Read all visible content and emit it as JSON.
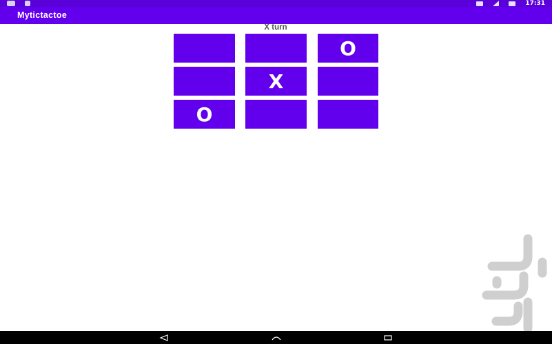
{
  "status_bar": {
    "clock": "17:31",
    "icons": [
      "notification-icon",
      "lock-icon",
      "vibrate-icon",
      "wifi-icon",
      "battery-icon"
    ]
  },
  "app_bar": {
    "title": "Mytictactoe"
  },
  "game": {
    "turn_text": "X turn",
    "board": [
      "",
      "",
      "O",
      "",
      "X",
      "",
      "O",
      "",
      ""
    ]
  },
  "nav_bar": {
    "icons": [
      "back-icon",
      "home-icon",
      "recents-icon"
    ]
  },
  "colors": {
    "primary": "#6200ee",
    "status_bar": "#5a00d9",
    "cell_text": "#ffffff",
    "turn_text": "#555555",
    "nav_bar": "#000000",
    "watermark": "#cfcfcf"
  }
}
